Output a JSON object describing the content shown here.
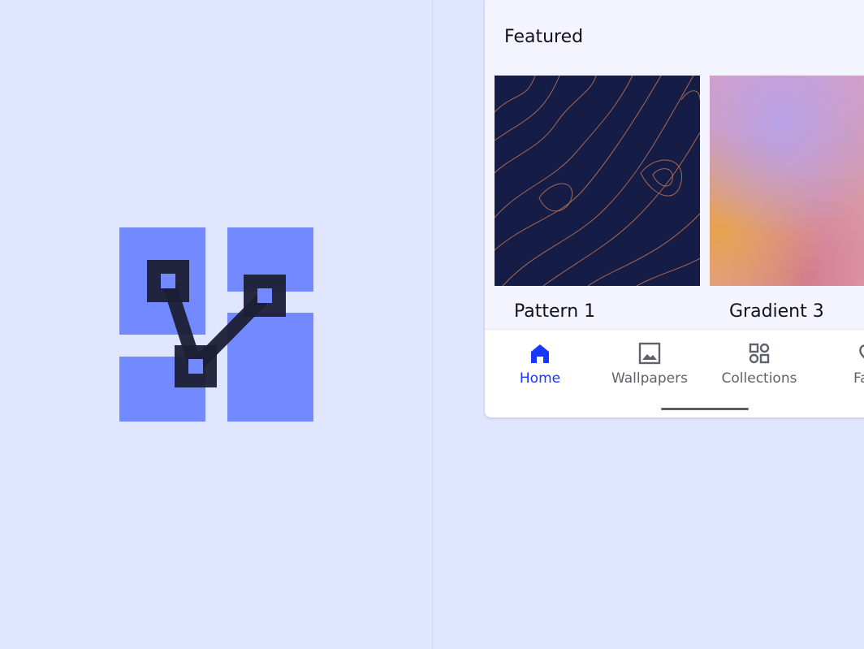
{
  "colors": {
    "background": "#e1e6ff",
    "surface": "#f3f4ff",
    "nav_background": "#ffffff",
    "accent": "#1739ff",
    "logo_tiles": "#7389ff",
    "logo_graph": "#1b1f35",
    "pattern_background": "#151c45",
    "pattern_lines": "#c1775a",
    "text_primary": "#111319",
    "text_secondary": "#5f616c"
  },
  "logo": {
    "icon": "graph-nodes-logo-icon"
  },
  "featured": {
    "title": "Featured",
    "cards": [
      {
        "title": "Pattern 1",
        "thumbnail": "topographic-pattern"
      },
      {
        "title": "Gradient 3",
        "thumbnail": "pastel-gradient"
      }
    ]
  },
  "nav": {
    "items": [
      {
        "label": "Home",
        "icon": "home-icon",
        "active": true
      },
      {
        "label": "Wallpapers",
        "icon": "image-icon",
        "active": false
      },
      {
        "label": "Collections",
        "icon": "collections-icon",
        "active": false
      },
      {
        "label": "Favc",
        "icon": "heart-icon",
        "active": false
      }
    ]
  }
}
